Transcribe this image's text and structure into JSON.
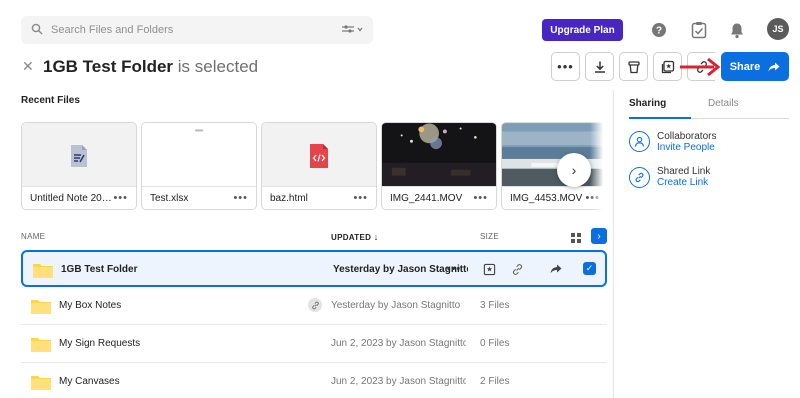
{
  "search": {
    "placeholder": "Search Files and Folders"
  },
  "header": {
    "upgrade_label": "Upgrade Plan",
    "avatar_initials": "JS"
  },
  "selection": {
    "name": "1GB Test Folder",
    "suffix": "is selected",
    "share_label": "Share"
  },
  "recent": {
    "label": "Recent Files",
    "files": [
      {
        "name": "Untitled Note 20…"
      },
      {
        "name": "Test.xlsx"
      },
      {
        "name": "baz.html"
      },
      {
        "name": "IMG_2441.MOV"
      },
      {
        "name": "IMG_4453.MOV"
      }
    ]
  },
  "panel": {
    "tabs": [
      {
        "label": "Sharing"
      },
      {
        "label": "Details"
      }
    ],
    "collaborators_title": "Collaborators",
    "collaborators_link": "Invite People",
    "shared_link_title": "Shared Link",
    "shared_link_link": "Create Link"
  },
  "table": {
    "headers": {
      "name": "NAME",
      "updated": "UPDATED",
      "size": "SIZE"
    },
    "rows": [
      {
        "name": "1GB Test Folder",
        "updated": "Yesterday by Jason Stagnitto",
        "size": ""
      },
      {
        "name": "My Box Notes",
        "updated": "Yesterday by Jason Stagnitto",
        "size": "3 Files"
      },
      {
        "name": "My Sign Requests",
        "updated": "Jun 2, 2023 by Jason Stagnitto",
        "size": "0 Files"
      },
      {
        "name": "My Canvases",
        "updated": "Jun 2, 2023 by Jason Stagnitto",
        "size": "2 Files"
      }
    ]
  },
  "colors": {
    "accent": "#0b6fe0",
    "upgrade": "#4826c2",
    "annotation": "#d9232e"
  }
}
